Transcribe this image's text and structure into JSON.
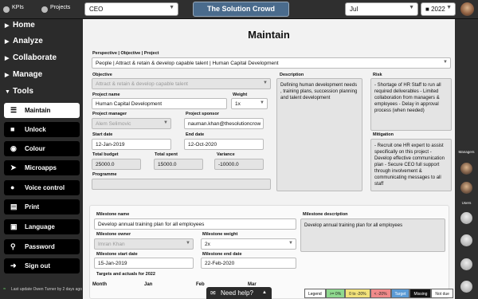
{
  "topbar": {
    "kpis_label": "KPIs",
    "projects_label": "Projects",
    "org_select": "CEO",
    "brand": "The Solution Crowd",
    "month_select": "Jul",
    "year_select": "2022"
  },
  "sidebar": {
    "nav": [
      "Home",
      "Analyze",
      "Collaborate",
      "Manage",
      "Tools"
    ],
    "tools": [
      "Maintain",
      "Unlock",
      "Colour",
      "Microapps",
      "Voice control",
      "Print",
      "Language",
      "Password",
      "Sign out"
    ],
    "status": "Last update Owen Turner by 2 days ago"
  },
  "page": {
    "title": "Maintain",
    "perspective_label": "Perspective | Objective | Project",
    "perspective_value": "People | Attract & retain & develop capable talent | Human Capital Development",
    "objective_label": "Objective",
    "objective_value": "Attract & retain & develop capable talent",
    "description_label": "Description",
    "description_value": "Defining human development needs , training plans, succession planning and talent development",
    "risk_label": "Risk",
    "risk_value": "- Shortage of HR Staff to run all required deliverables - Limited collaboration from managers & employees - Delay in approval process (when needed)",
    "project_name_label": "Project name",
    "project_name_value": "Human Capital Development",
    "weight_label": "Weight",
    "weight_value": "1x",
    "project_manager_label": "Project manager",
    "project_manager_value": "Alem Selimovic",
    "project_sponsor_label": "Project sponsor",
    "project_sponsor_value": "nauman.khan@thesolutioncrow",
    "start_date_label": "Start date",
    "start_date_value": "12-Jan-2019",
    "end_date_label": "End date",
    "end_date_value": "12-Oct-2020",
    "mitigation_label": "Mitigation",
    "mitigation_value": "- Recruit one HR expert to assist specifically on this project - Develop effective communication plan - Secure CEO full support through involvement & communicating messages to all staff",
    "total_budget_label": "Total budget",
    "total_budget_value": "25000.0",
    "total_spent_label": "Total spent",
    "total_spent_value": "15000.0",
    "variance_label": "Variance",
    "variance_value": "-10000.0",
    "programme_label": "Programme",
    "programme_value": ""
  },
  "milestone": {
    "name_label": "Milestone name",
    "name_value": "Develop annual training plan for all employees",
    "description_label": "Milestone description",
    "description_value": "Develop annual training plan for all employees",
    "owner_label": "Milestone owner",
    "owner_value": "Imran Khan",
    "weight_label": "Milestone weight",
    "weight_value": "2x",
    "start_label": "Milestone start date",
    "start_value": "15-Jan-2019",
    "end_label": "Milestone end date",
    "end_value": "22-Feb-2020",
    "targets_label": "Targets and actuals for 2022",
    "table_headers": [
      "Month",
      "Jan",
      "Feb",
      "Mar"
    ]
  },
  "rightbar": {
    "managers_label": "Managers",
    "users_label": "Users"
  },
  "help": {
    "label": "Need help?"
  },
  "legend": {
    "items": [
      "Legend",
      ">= 0%",
      "0 to -20%",
      "< -20%",
      "Target",
      "Missing",
      "Not due"
    ],
    "colors": [
      "#ffffff",
      "#8fd98f",
      "#f2e27a",
      "#f08a8a",
      "#5b9bd5",
      "#111111",
      "#ffffff"
    ]
  }
}
